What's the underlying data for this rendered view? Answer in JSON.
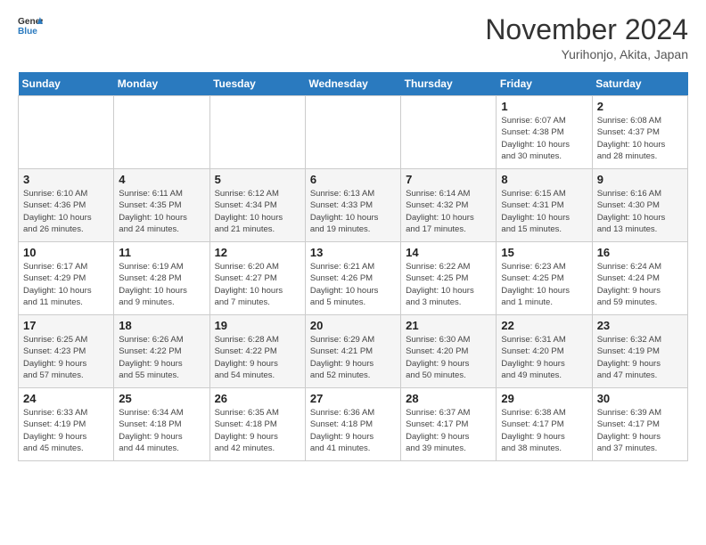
{
  "logo": {
    "general": "General",
    "blue": "Blue"
  },
  "title": "November 2024",
  "subtitle": "Yurihonjo, Akita, Japan",
  "days_of_week": [
    "Sunday",
    "Monday",
    "Tuesday",
    "Wednesday",
    "Thursday",
    "Friday",
    "Saturday"
  ],
  "weeks": [
    [
      {
        "day": "",
        "info": ""
      },
      {
        "day": "",
        "info": ""
      },
      {
        "day": "",
        "info": ""
      },
      {
        "day": "",
        "info": ""
      },
      {
        "day": "",
        "info": ""
      },
      {
        "day": "1",
        "info": "Sunrise: 6:07 AM\nSunset: 4:38 PM\nDaylight: 10 hours\nand 30 minutes."
      },
      {
        "day": "2",
        "info": "Sunrise: 6:08 AM\nSunset: 4:37 PM\nDaylight: 10 hours\nand 28 minutes."
      }
    ],
    [
      {
        "day": "3",
        "info": "Sunrise: 6:10 AM\nSunset: 4:36 PM\nDaylight: 10 hours\nand 26 minutes."
      },
      {
        "day": "4",
        "info": "Sunrise: 6:11 AM\nSunset: 4:35 PM\nDaylight: 10 hours\nand 24 minutes."
      },
      {
        "day": "5",
        "info": "Sunrise: 6:12 AM\nSunset: 4:34 PM\nDaylight: 10 hours\nand 21 minutes."
      },
      {
        "day": "6",
        "info": "Sunrise: 6:13 AM\nSunset: 4:33 PM\nDaylight: 10 hours\nand 19 minutes."
      },
      {
        "day": "7",
        "info": "Sunrise: 6:14 AM\nSunset: 4:32 PM\nDaylight: 10 hours\nand 17 minutes."
      },
      {
        "day": "8",
        "info": "Sunrise: 6:15 AM\nSunset: 4:31 PM\nDaylight: 10 hours\nand 15 minutes."
      },
      {
        "day": "9",
        "info": "Sunrise: 6:16 AM\nSunset: 4:30 PM\nDaylight: 10 hours\nand 13 minutes."
      }
    ],
    [
      {
        "day": "10",
        "info": "Sunrise: 6:17 AM\nSunset: 4:29 PM\nDaylight: 10 hours\nand 11 minutes."
      },
      {
        "day": "11",
        "info": "Sunrise: 6:19 AM\nSunset: 4:28 PM\nDaylight: 10 hours\nand 9 minutes."
      },
      {
        "day": "12",
        "info": "Sunrise: 6:20 AM\nSunset: 4:27 PM\nDaylight: 10 hours\nand 7 minutes."
      },
      {
        "day": "13",
        "info": "Sunrise: 6:21 AM\nSunset: 4:26 PM\nDaylight: 10 hours\nand 5 minutes."
      },
      {
        "day": "14",
        "info": "Sunrise: 6:22 AM\nSunset: 4:25 PM\nDaylight: 10 hours\nand 3 minutes."
      },
      {
        "day": "15",
        "info": "Sunrise: 6:23 AM\nSunset: 4:25 PM\nDaylight: 10 hours\nand 1 minute."
      },
      {
        "day": "16",
        "info": "Sunrise: 6:24 AM\nSunset: 4:24 PM\nDaylight: 9 hours\nand 59 minutes."
      }
    ],
    [
      {
        "day": "17",
        "info": "Sunrise: 6:25 AM\nSunset: 4:23 PM\nDaylight: 9 hours\nand 57 minutes."
      },
      {
        "day": "18",
        "info": "Sunrise: 6:26 AM\nSunset: 4:22 PM\nDaylight: 9 hours\nand 55 minutes."
      },
      {
        "day": "19",
        "info": "Sunrise: 6:28 AM\nSunset: 4:22 PM\nDaylight: 9 hours\nand 54 minutes."
      },
      {
        "day": "20",
        "info": "Sunrise: 6:29 AM\nSunset: 4:21 PM\nDaylight: 9 hours\nand 52 minutes."
      },
      {
        "day": "21",
        "info": "Sunrise: 6:30 AM\nSunset: 4:20 PM\nDaylight: 9 hours\nand 50 minutes."
      },
      {
        "day": "22",
        "info": "Sunrise: 6:31 AM\nSunset: 4:20 PM\nDaylight: 9 hours\nand 49 minutes."
      },
      {
        "day": "23",
        "info": "Sunrise: 6:32 AM\nSunset: 4:19 PM\nDaylight: 9 hours\nand 47 minutes."
      }
    ],
    [
      {
        "day": "24",
        "info": "Sunrise: 6:33 AM\nSunset: 4:19 PM\nDaylight: 9 hours\nand 45 minutes."
      },
      {
        "day": "25",
        "info": "Sunrise: 6:34 AM\nSunset: 4:18 PM\nDaylight: 9 hours\nand 44 minutes."
      },
      {
        "day": "26",
        "info": "Sunrise: 6:35 AM\nSunset: 4:18 PM\nDaylight: 9 hours\nand 42 minutes."
      },
      {
        "day": "27",
        "info": "Sunrise: 6:36 AM\nSunset: 4:18 PM\nDaylight: 9 hours\nand 41 minutes."
      },
      {
        "day": "28",
        "info": "Sunrise: 6:37 AM\nSunset: 4:17 PM\nDaylight: 9 hours\nand 39 minutes."
      },
      {
        "day": "29",
        "info": "Sunrise: 6:38 AM\nSunset: 4:17 PM\nDaylight: 9 hours\nand 38 minutes."
      },
      {
        "day": "30",
        "info": "Sunrise: 6:39 AM\nSunset: 4:17 PM\nDaylight: 9 hours\nand 37 minutes."
      }
    ]
  ]
}
